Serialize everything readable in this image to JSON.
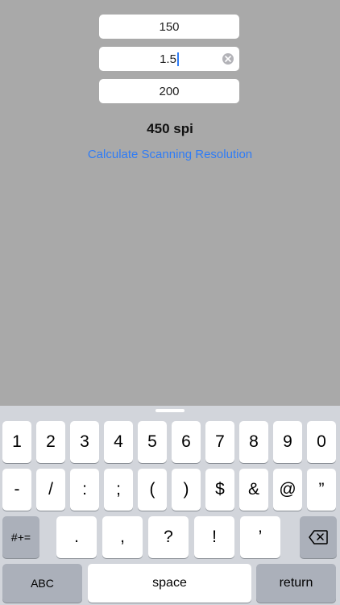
{
  "fields": [
    {
      "value": "150"
    },
    {
      "value": "1.5"
    },
    {
      "value": "200"
    }
  ],
  "result": "450 spi",
  "calc_button_label": "Calculate Scanning Resolution",
  "keyboard": {
    "row1": [
      "1",
      "2",
      "3",
      "4",
      "5",
      "6",
      "7",
      "8",
      "9",
      "0"
    ],
    "row2": [
      "-",
      "/",
      ":",
      ";",
      "(",
      ")",
      "$",
      "&",
      "@",
      "”"
    ],
    "row3": {
      "symbols_label": "#+=",
      "keys": [
        ".",
        ",",
        "?",
        "!",
        "’"
      ]
    },
    "row4": {
      "abc_label": "ABC",
      "space_label": "space",
      "return_label": "return"
    }
  },
  "icons": {
    "clear": "clear-text-icon",
    "delete": "backspace-icon"
  },
  "colors": {
    "background": "#a9a9a9",
    "link": "#2f7cf6",
    "keyboard": "#d2d5db"
  }
}
